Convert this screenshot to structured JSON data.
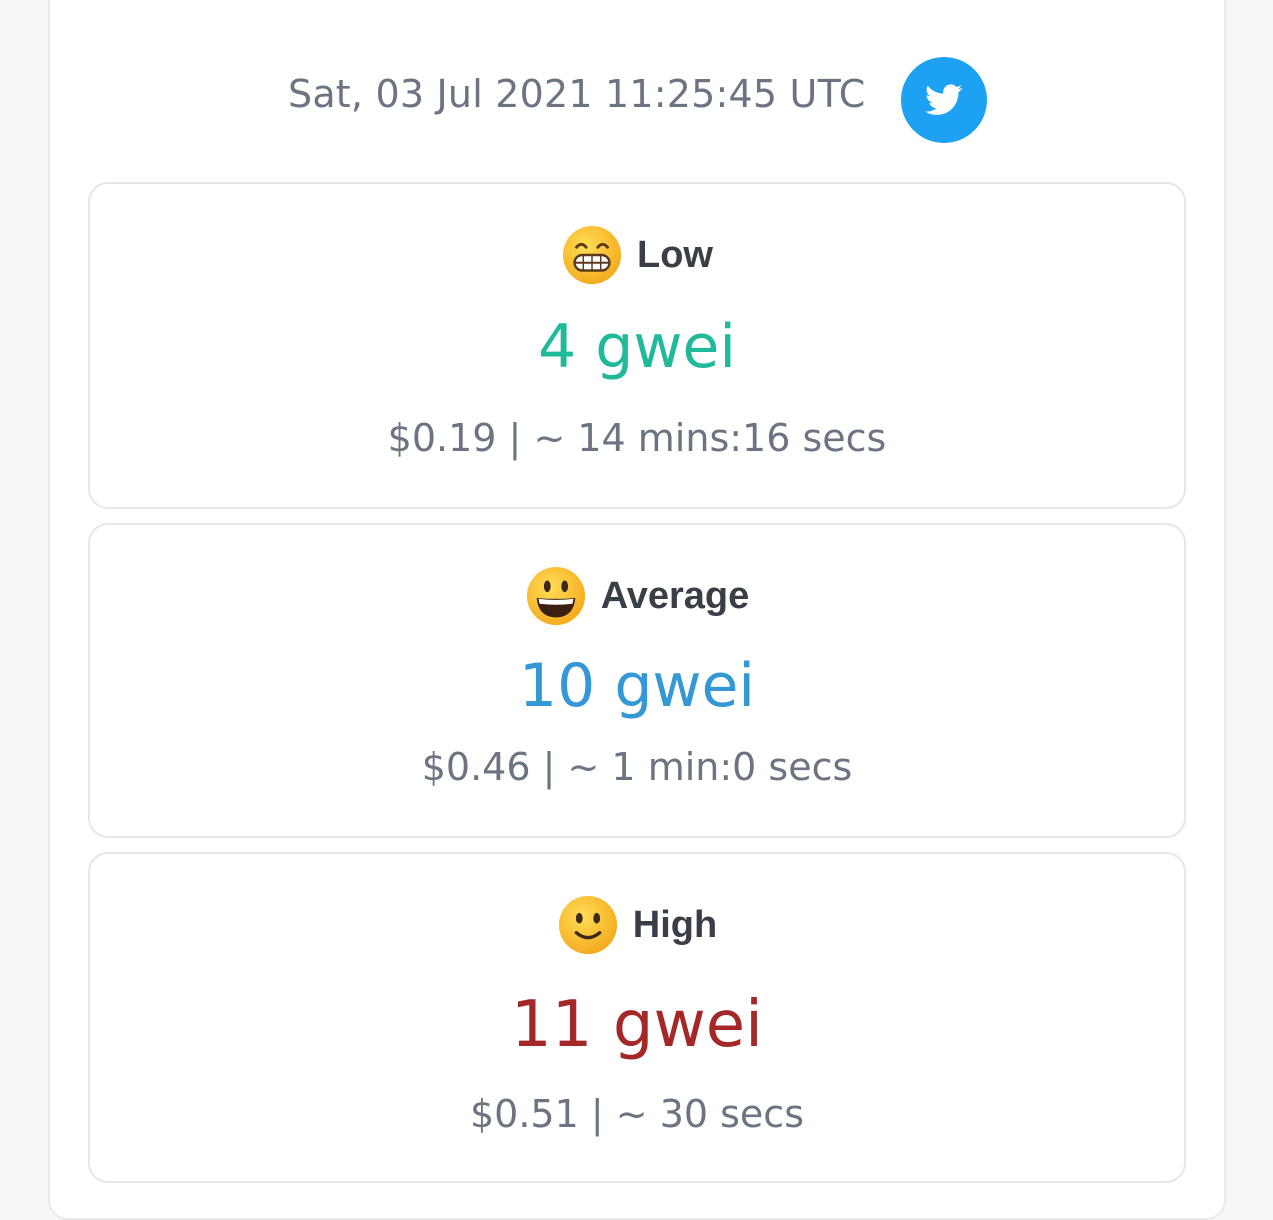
{
  "header": {
    "timestamp": "Sat, 03 Jul 2021 11:25:45 UTC",
    "twitter_icon": "twitter-bird-icon",
    "twitter_color": "#1da1f2"
  },
  "tiers": {
    "low": {
      "emoji": "grinning-face-with-smiling-eyes",
      "label": "Low",
      "price": "4 gwei",
      "cost": "$0.19",
      "separator": "|",
      "time": "~ 14 mins:16 secs",
      "color": "#20b99a"
    },
    "average": {
      "emoji": "grinning-face",
      "label": "Average",
      "price": "10 gwei",
      "cost": "$0.46",
      "separator": "|",
      "time": "~ 1 min:0 secs",
      "color": "#3497d6"
    },
    "high": {
      "emoji": "slightly-smiling-face",
      "label": "High",
      "price": "11 gwei",
      "cost": "$0.51",
      "separator": "|",
      "time": "~ 30 secs",
      "color": "#a52828"
    }
  }
}
